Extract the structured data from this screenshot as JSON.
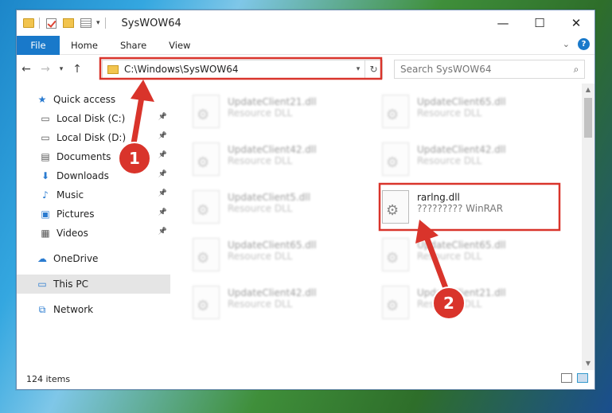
{
  "window": {
    "title": "SysWOW64",
    "minimize_glyph": "—",
    "maximize_glyph": "☐",
    "close_glyph": "✕"
  },
  "ribbon": {
    "tabs": [
      "File",
      "Home",
      "Share",
      "View"
    ],
    "help_glyph": "?"
  },
  "navigation": {
    "address": "C:\\Windows\\SysWOW64",
    "search_placeholder": "Search SysWOW64"
  },
  "sidebar": {
    "items": [
      {
        "label": "Quick access",
        "icon": "star-icon",
        "pinned": false
      },
      {
        "label": "Local Disk (C:)",
        "icon": "drive-icon",
        "pinned": true
      },
      {
        "label": "Local Disk (D:)",
        "icon": "drive-icon",
        "pinned": true
      },
      {
        "label": "Documents",
        "icon": "documents-icon",
        "pinned": true
      },
      {
        "label": "Downloads",
        "icon": "download-icon",
        "pinned": true
      },
      {
        "label": "Music",
        "icon": "music-icon",
        "pinned": true
      },
      {
        "label": "Pictures",
        "icon": "pictures-icon",
        "pinned": true
      },
      {
        "label": "Videos",
        "icon": "video-icon",
        "pinned": true
      },
      {
        "label": "OneDrive",
        "icon": "cloud-icon",
        "pinned": false
      },
      {
        "label": "This PC",
        "icon": "computer-icon",
        "pinned": false,
        "selected": true
      },
      {
        "label": "Network",
        "icon": "network-icon",
        "pinned": false
      }
    ]
  },
  "files": [
    {
      "name": "UpdateClient21.dll",
      "type": "Resource DLL",
      "blurred": true
    },
    {
      "name": "UpdateClient65.dll",
      "type": "Resource DLL",
      "blurred": true
    },
    {
      "name": "UpdateClient42.dll",
      "type": "Resource DLL",
      "blurred": true
    },
    {
      "name": "UpdateClient42.dll",
      "type": "Resource DLL",
      "blurred": true
    },
    {
      "name": "UpdateClient5.dll",
      "type": "Resource DLL",
      "blurred": true
    },
    {
      "name": "rarlng.dll",
      "type": "????????? WinRAR",
      "blurred": false
    },
    {
      "name": "UpdateClient65.dll",
      "type": "Resource DLL",
      "blurred": true
    },
    {
      "name": "UpdateClient65.dll",
      "type": "Resource DLL",
      "blurred": true
    },
    {
      "name": "UpdateClient42.dll",
      "type": "Resource DLL",
      "blurred": true
    },
    {
      "name": "UpdateClient21.dll",
      "type": "Resource DLL",
      "blurred": true
    }
  ],
  "status": {
    "item_count": "124 items"
  },
  "annotations": {
    "step1": "1",
    "step2": "2",
    "color": "#d9342b"
  }
}
